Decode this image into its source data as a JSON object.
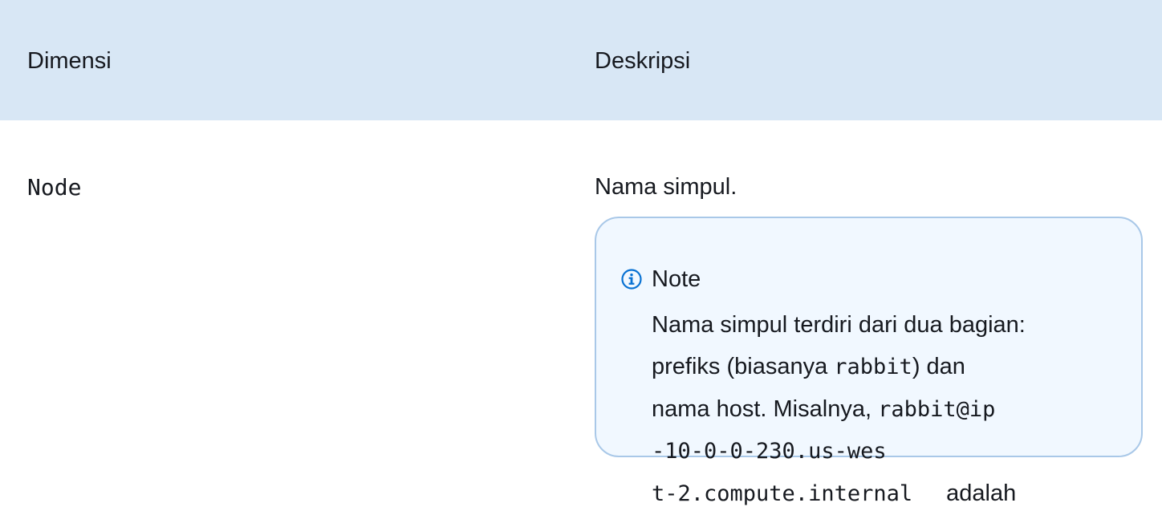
{
  "table": {
    "headers": {
      "dimension": "Dimensi",
      "description": "Deskripsi"
    },
    "row": {
      "dimension": "Node",
      "description": "Nama simpul."
    }
  },
  "note": {
    "icon": "info-icon",
    "title": "Note",
    "line1": "Nama simpul terdiri dari dua bagian:",
    "line2_text": "prefiks (biasanya ",
    "line2_code": "rabbit",
    "line2_end": ") dan",
    "line3_text": "nama host. Misalnya, ",
    "line3_code": "rabbit@ip",
    "line4_code": "-10-0-0-230.us-wes",
    "line5_code": "t-2.compute.internal",
    "line5_end": "adalah"
  }
}
